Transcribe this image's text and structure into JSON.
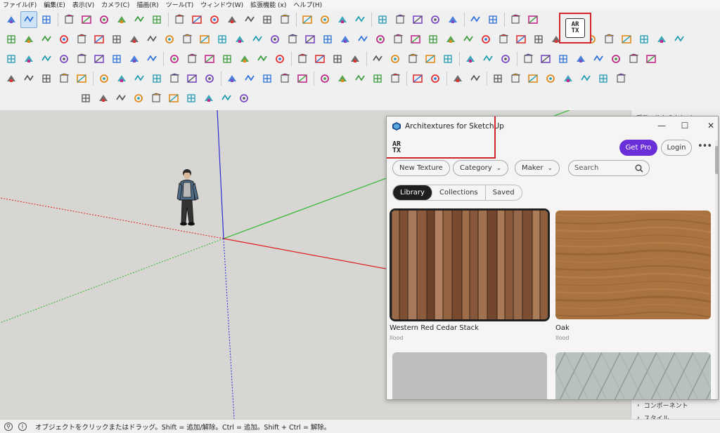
{
  "menu": [
    "ファイル(F)",
    "編集(E)",
    "表示(V)",
    "カメラ(C)",
    "描画(R)",
    "ツール(T)",
    "ウィンドウ(W)",
    "拡張機能 (x)",
    "ヘルプ(H)"
  ],
  "toolbar": {
    "artx_button": {
      "line1": "AR",
      "line2": "TX",
      "icon": "artx-extension-icon"
    }
  },
  "tray": {
    "title": "デフォルトのトレイ",
    "items": [
      {
        "label": "コンポーネント",
        "icon": "chevron-right-icon"
      },
      {
        "label": "スタイル",
        "icon": "chevron-right-icon"
      }
    ]
  },
  "status": {
    "hint": "オブジェクトをクリックまたはドラッグ。Shift = 追加/解除。Ctrl = 追加。Shift + Ctrl = 解除。",
    "icons": [
      "geolocation-icon",
      "info-icon"
    ]
  },
  "panel": {
    "title": "Architextures for SketchUp",
    "logo": {
      "line1": "AR",
      "line2": "TX"
    },
    "window_controls": {
      "minimize": "—",
      "maximize": "☐",
      "close": "✕"
    },
    "get_pro": "Get Pro",
    "login": "Login",
    "more": "•••",
    "filters": {
      "new_texture": "New Texture",
      "category": "Category",
      "maker": "Maker",
      "search_placeholder": "Search"
    },
    "tabs": [
      {
        "label": "Library",
        "active": true
      },
      {
        "label": "Collections",
        "active": false
      },
      {
        "label": "Saved",
        "active": false
      }
    ],
    "textures": [
      {
        "name": "Western Red Cedar Stack",
        "maker": "Ilood",
        "selected": true,
        "color": "#8a5a3b"
      },
      {
        "name": "Oak",
        "maker": "Ilood",
        "selected": false,
        "color": "#a8733f"
      },
      {
        "name": "",
        "maker": "",
        "selected": false,
        "color": "#bdbdbb"
      },
      {
        "name": "",
        "maker": "",
        "selected": false,
        "color": "#b7c2bf"
      }
    ]
  },
  "colors": {
    "accent_purple": "#6b2fd9",
    "highlight_red": "#d0262b",
    "axis_red": "#e02020",
    "axis_green": "#2fb82f",
    "axis_blue": "#2b2bd0",
    "viewport_bg": "#d7d6d2"
  }
}
